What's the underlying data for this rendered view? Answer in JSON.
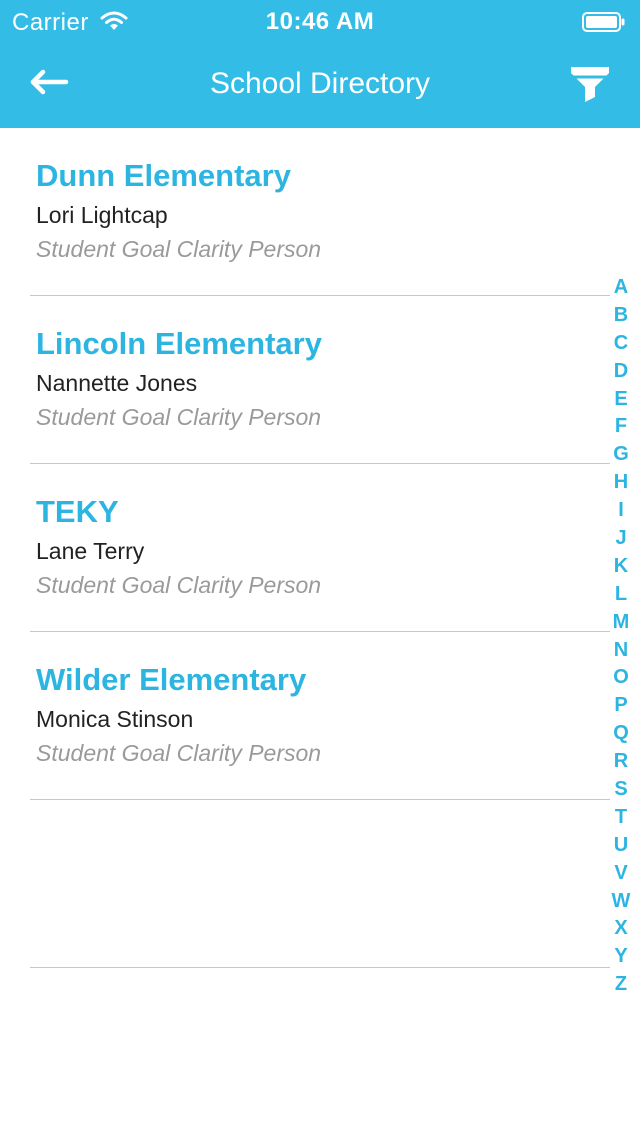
{
  "status_bar": {
    "carrier": "Carrier",
    "time": "10:46 AM"
  },
  "nav": {
    "title": "School Directory",
    "back_icon": "arrow-left-icon",
    "filter_icon": "funnel-icon"
  },
  "colors": {
    "accent": "#33bde6",
    "school_name": "#2db5e2",
    "role_text": "#9a9a9a"
  },
  "schools": [
    {
      "name": "Dunn Elementary",
      "person": "Lori Lightcap",
      "role": "Student Goal Clarity Person"
    },
    {
      "name": "Lincoln Elementary",
      "person": "Nannette Jones",
      "role": "Student Goal Clarity Person"
    },
    {
      "name": "TEKY",
      "person": "Lane Terry",
      "role": "Student Goal Clarity Person"
    },
    {
      "name": "Wilder Elementary",
      "person": "Monica Stinson",
      "role": "Student Goal Clarity Person"
    }
  ],
  "index_letters": [
    "A",
    "B",
    "C",
    "D",
    "E",
    "F",
    "G",
    "H",
    "I",
    "J",
    "K",
    "L",
    "M",
    "N",
    "O",
    "P",
    "Q",
    "R",
    "S",
    "T",
    "U",
    "V",
    "W",
    "X",
    "Y",
    "Z"
  ]
}
